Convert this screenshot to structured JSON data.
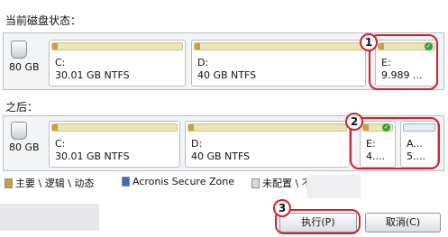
{
  "current": {
    "label": "当前磁盘状态：",
    "disk_size": "80 GB",
    "partitions": [
      {
        "name": "C:",
        "info": "30.01 GB  NTFS"
      },
      {
        "name": "D:",
        "info": "40 GB  NTFS"
      },
      {
        "name": "E:",
        "info": "9.989 ..."
      }
    ]
  },
  "after": {
    "label": "之后：",
    "disk_size": "80 GB",
    "partitions": [
      {
        "name": "C:",
        "info": "30.01 GB  NTFS"
      },
      {
        "name": "D:",
        "info": "40 GB  NTFS"
      },
      {
        "name": "E:",
        "info": "4...."
      },
      {
        "name": "A...",
        "info": "5...."
      }
    ]
  },
  "legend": {
    "primary": "主要 \\ 逻辑 \\ 动态",
    "acronis": "Acronis Secure Zone",
    "unallocated": "未配置 \\ 不受支持"
  },
  "markers": [
    "1",
    "2",
    "3"
  ],
  "buttons": {
    "execute": "执行(P)",
    "cancel": "取消(C)"
  },
  "colors": {
    "marker_red": "#d61f2a",
    "partition_fill": "#c9a23c",
    "check_green": "#2fa43a"
  }
}
